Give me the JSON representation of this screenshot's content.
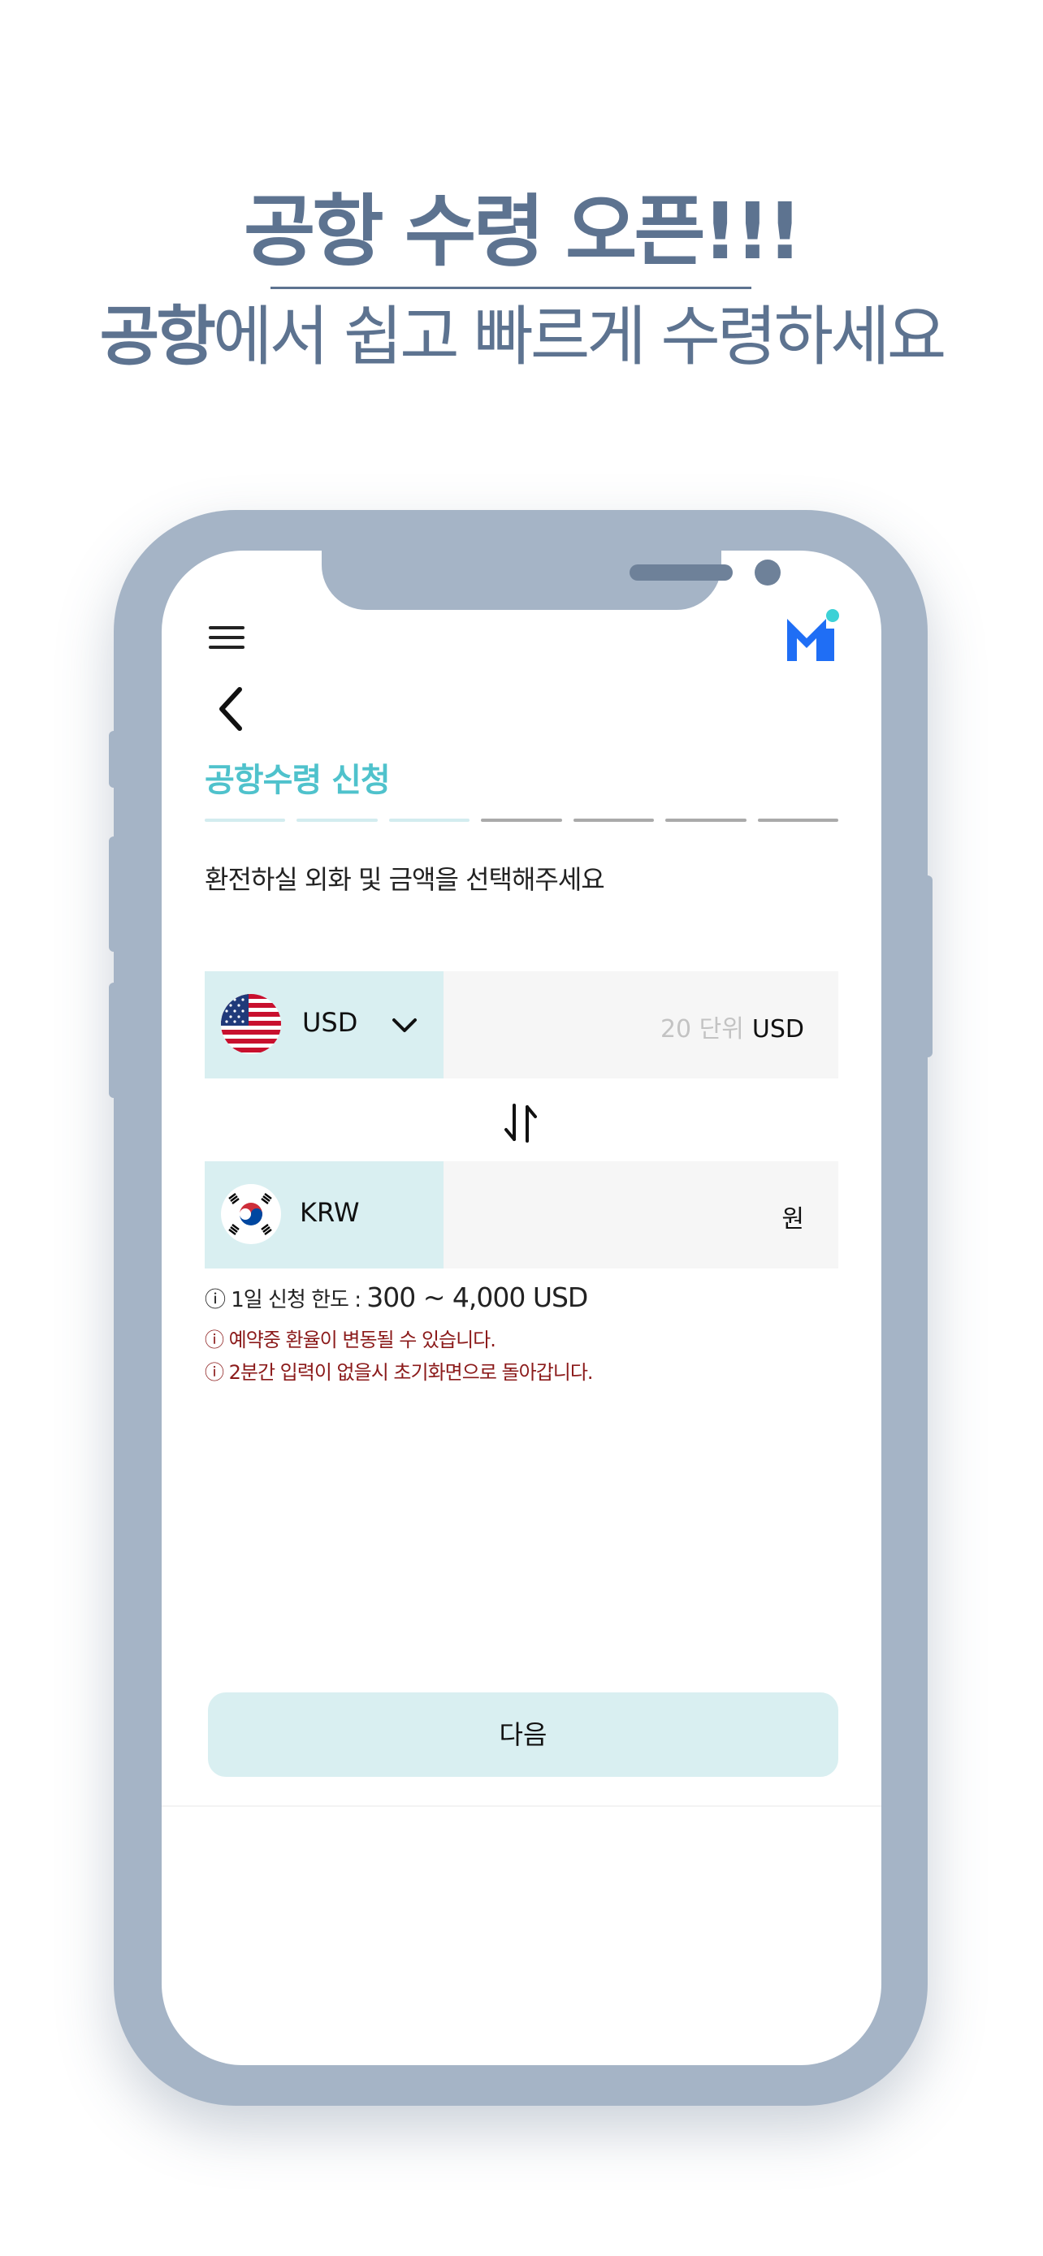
{
  "hero": {
    "title": "공항 수령 오픈!!!",
    "subtitle_strong": "공항",
    "subtitle_rest": "에서 쉽고 빠르게 수령하세요"
  },
  "app": {
    "menu_icon": "hamburger-menu-icon",
    "logo_icon": "brand-logo-icon",
    "back_icon": "chevron-left-icon",
    "page_title": "공항수령 신청",
    "steps": {
      "total": 7,
      "completed": 3
    },
    "instruction": "환전하실 외화 및 금액을 선택해주세요",
    "from_currency": {
      "code": "USD",
      "flag": "us-flag-icon",
      "amount_placeholder": "20 단위",
      "unit": "USD"
    },
    "swap_icon": "swap-arrows-icon",
    "to_currency": {
      "code": "KRW",
      "flag": "kr-flag-icon",
      "unit": "원"
    },
    "limit_prefix": "ⓘ 1일 신청 한도 : ",
    "limit_range": "300 ~ 4,000 USD",
    "warning_rate": "ⓘ 예약중 환율이 변동될 수 있습니다.",
    "warning_timeout": "ⓘ 2분간 입력이 없을시 초기화면으로 돌아갑니다.",
    "next_label": "다음"
  },
  "colors": {
    "accent": "#4fc2cc",
    "phone_frame": "#a5b4c6",
    "hero_text": "#5d7390",
    "warning": "#8b1a1a",
    "logo_blue": "#1f6ef5"
  }
}
